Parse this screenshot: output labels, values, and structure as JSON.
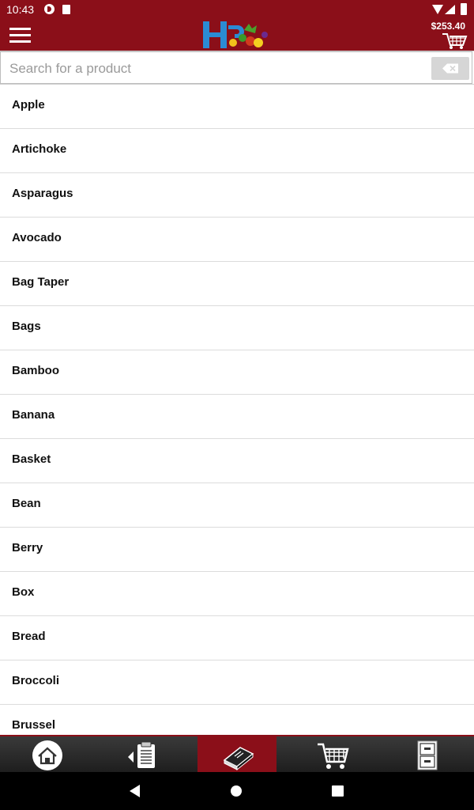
{
  "status_bar": {
    "time": "10:43"
  },
  "header": {
    "cart_total": "$253.40"
  },
  "search": {
    "placeholder": "Search for a product",
    "value": ""
  },
  "products": [
    "Apple",
    "Artichoke",
    "Asparagus",
    "Avocado",
    "Bag Taper",
    "Bags",
    "Bamboo",
    "Banana",
    "Basket",
    "Bean",
    "Berry",
    "Box",
    "Bread",
    "Broccoli",
    "Brussel"
  ],
  "nav": {
    "active": "catalog",
    "items": [
      "home-icon",
      "orders-icon",
      "catalog-icon",
      "cart-icon",
      "cabinet-icon"
    ]
  },
  "colors": {
    "brand": "#8b0f19",
    "nav_bg": "#262626"
  }
}
